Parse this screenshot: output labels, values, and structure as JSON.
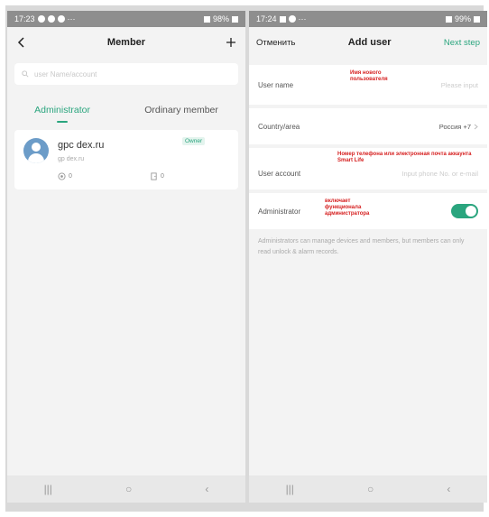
{
  "left": {
    "status": {
      "time": "17:23",
      "battery": "98%"
    },
    "title": "Member",
    "back_icon": "back-arrow-icon",
    "add_icon": "plus-icon",
    "search_placeholder": "user Name/account",
    "tabs": [
      {
        "label": "Administrator",
        "active": true
      },
      {
        "label": "Ordinary member",
        "active": false
      }
    ],
    "member": {
      "name": "gpc          dex.ru",
      "sub": "gp                     dex.ru",
      "badge": "Owner",
      "devices_count": "0",
      "doors_count": "0"
    }
  },
  "right": {
    "status": {
      "time": "17:24",
      "battery": "99%"
    },
    "cancel": "Отменить",
    "title": "Add user",
    "next": "Next step",
    "fields": {
      "user_name_label": "User name",
      "user_name_placeholder": "Please input",
      "user_name_annotation": "Имя нового пользователя",
      "country_label": "Country/area",
      "country_value": "Россия +7",
      "account_label": "User account",
      "account_placeholder": "Input phone No. or e-mail",
      "account_annotation": "Номер телефона или электронная почта аккаунта Smart Life",
      "admin_label": "Administrator",
      "admin_annotation": "включает функционала администратора",
      "admin_enabled": true
    },
    "hint": "Administrators can manage devices and members, but members can only read unlock & alarm records."
  },
  "colors": {
    "accent": "#2aa57e",
    "annotation": "#d62020"
  }
}
